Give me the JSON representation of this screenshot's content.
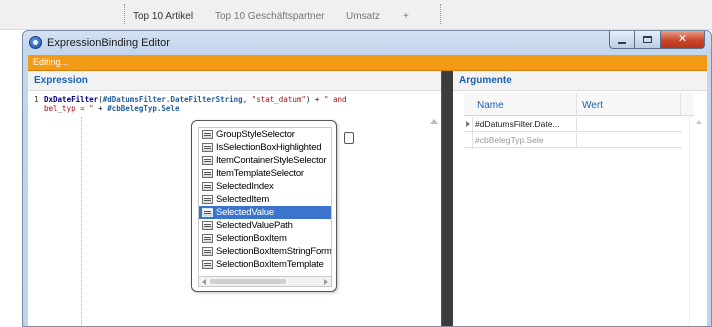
{
  "background_app": {
    "tabs": [
      "Top 10 Artikel",
      "Top 10 Geschäftspartner",
      "Umsatz",
      "+"
    ]
  },
  "window": {
    "title": "ExpressionBinding Editor",
    "status": "Editing..."
  },
  "expression_panel": {
    "header": "Expression",
    "line_number": "1",
    "code": {
      "line1_fn": "DxDateFilter",
      "line1_open": "(",
      "line1_var": "#dDatumsFilter.DateFilterString",
      "line1_mid": ", ",
      "line1_str": "\"stat_datum\"",
      "line1_close": ") + ",
      "line1_str2": "\" and",
      "line2_str": "bel_typ = \"",
      "line2_plus": " + ",
      "line2_var": "#cbBelegTyp.Sele"
    }
  },
  "autocomplete": {
    "items": [
      "GroupStyleSelector",
      "IsSelectionBoxHighlighted",
      "ItemContainerStyleSelector",
      "ItemTemplateSelector",
      "SelectedIndex",
      "SelectedItem",
      "SelectedValue",
      "SelectedValuePath",
      "SelectionBoxItem",
      "SelectionBoxItemStringFormat",
      "SelectionBoxItemTemplate"
    ],
    "selected_index": 6
  },
  "arguments_panel": {
    "header": "Argumente",
    "columns": {
      "name": "Name",
      "wert": "Wert"
    },
    "rows": [
      {
        "name": "#dDatumsFilter.Date...",
        "wert": ""
      },
      {
        "name": "#cbBelegTyp.Sele",
        "wert": ""
      }
    ]
  },
  "colors": {
    "accent_orange": "#f39b17",
    "header_blue": "#1c63b5",
    "selection_blue": "#3a74cc"
  }
}
